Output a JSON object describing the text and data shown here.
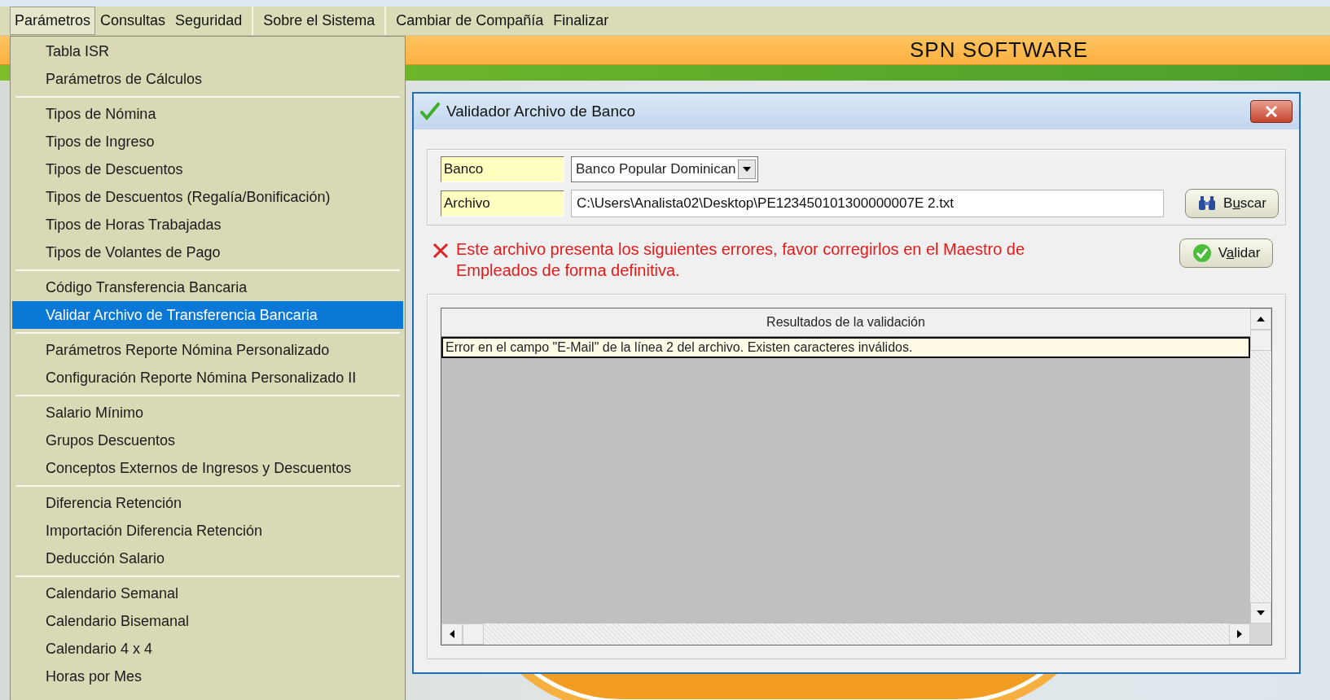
{
  "menu_bar": [
    [
      {
        "label": "Parámetros",
        "selected": true
      },
      {
        "label": "Consultas",
        "selected": false
      },
      {
        "label": "Seguridad",
        "selected": false
      }
    ],
    [
      {
        "label": "Sobre el Sistema",
        "selected": false
      }
    ],
    [
      {
        "label": "Cambiar de Compañía",
        "selected": false
      },
      {
        "label": "Finalizar",
        "selected": false
      }
    ]
  ],
  "dropdown": [
    [
      {
        "label": "Tabla  ISR",
        "selected": false
      },
      {
        "label": "Parámetros de Cálculos",
        "selected": false
      }
    ],
    [
      {
        "label": "Tipos de Nómina",
        "selected": false
      },
      {
        "label": "Tipos de Ingreso",
        "selected": false
      },
      {
        "label": "Tipos de Descuentos",
        "selected": false
      },
      {
        "label": "Tipos de Descuentos (Regalía/Bonificación)",
        "selected": false
      },
      {
        "label": "Tipos de Horas Trabajadas",
        "selected": false
      },
      {
        "label": "Tipos de Volantes de Pago",
        "selected": false
      }
    ],
    [
      {
        "label": "Código Transferencia Bancaria",
        "selected": false
      },
      {
        "label": "Validar Archivo de Transferencia Bancaria",
        "selected": true
      }
    ],
    [
      {
        "label": "Parámetros Reporte Nómina Personalizado",
        "selected": false
      },
      {
        "label": "Configuración Reporte Nómina Personalizado II",
        "selected": false
      }
    ],
    [
      {
        "label": "Salario Mínimo",
        "selected": false
      },
      {
        "label": "Grupos Descuentos",
        "selected": false
      },
      {
        "label": "Conceptos Externos de Ingresos y Descuentos",
        "selected": false
      }
    ],
    [
      {
        "label": "Diferencia Retención",
        "selected": false
      },
      {
        "label": "Importación Diferencia Retención",
        "selected": false
      },
      {
        "label": "Deducción Salario",
        "selected": false
      }
    ],
    [
      {
        "label": "Calendario Semanal",
        "selected": false
      },
      {
        "label": "Calendario Bisemanal",
        "selected": false
      },
      {
        "label": "Calendario 4 x 4",
        "selected": false
      },
      {
        "label": "Horas por Mes",
        "selected": false
      }
    ]
  ],
  "banner": {
    "title": "SPN SOFTWARE"
  },
  "dialog": {
    "title": "Validador Archivo de Banco",
    "fields": [
      {
        "label": "Banco",
        "kind": "combo",
        "value": "Banco Popular Dominican"
      },
      {
        "label": "Archivo",
        "kind": "text",
        "value": "C:\\Users\\Analista02\\Desktop\\PE123450101300000007E 2.txt"
      }
    ],
    "search_button": {
      "label": "Buscar",
      "access_key_underlined": true
    },
    "error_message": "Este archivo presenta los siguientes errores, favor corregirlos en el Maestro de Empleados de forma definitiva.",
    "validate_button": {
      "label": "Validar",
      "access_key_underlined": true
    },
    "results": {
      "columns": [
        "Resultados de la validación"
      ],
      "rows": [
        "Error en el campo \"E-Mail\" de la línea 2 del archivo. Existen caracteres inválidos."
      ]
    }
  }
}
